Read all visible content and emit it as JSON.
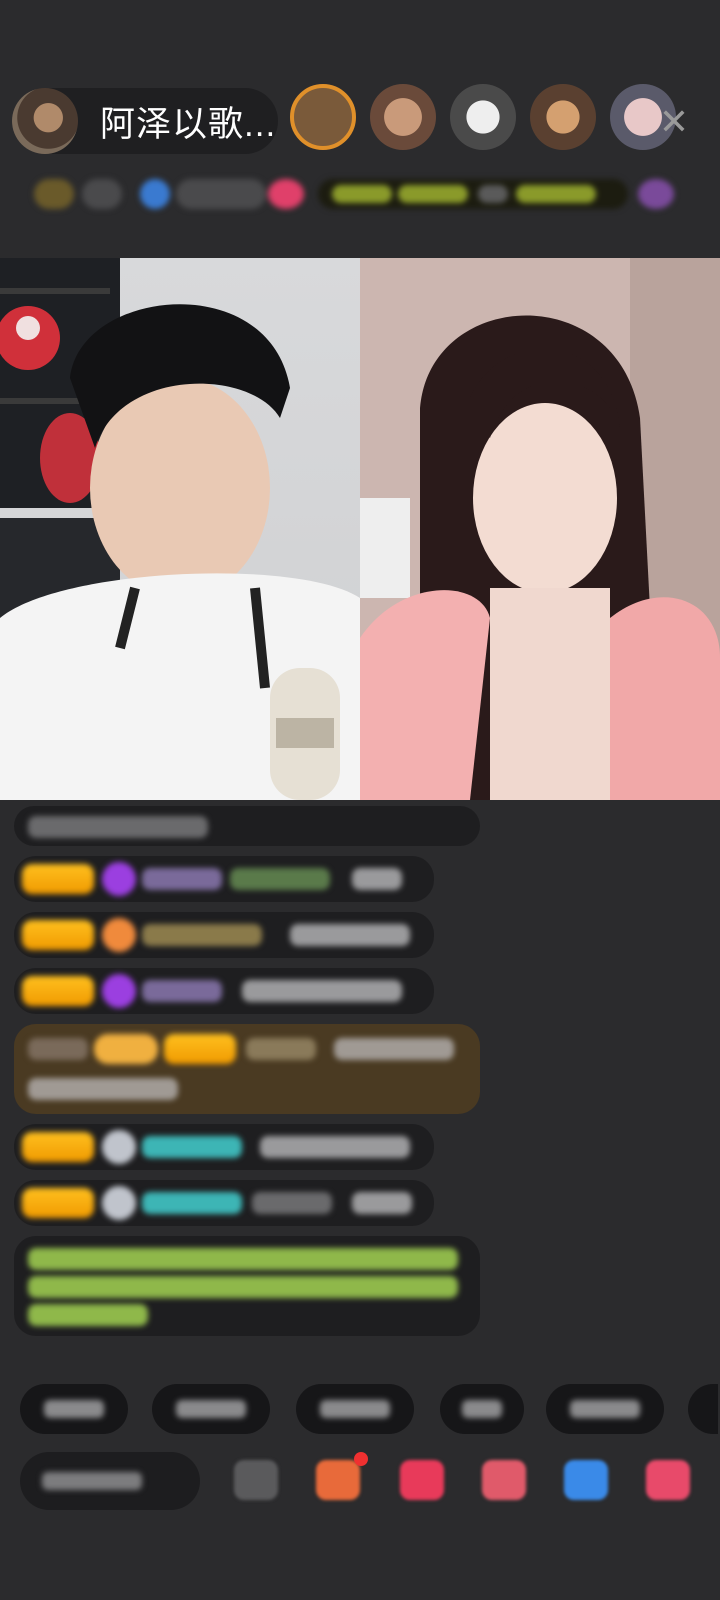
{
  "host": {
    "name": "阿泽以歌..."
  },
  "viewers": {
    "count_shown": 5,
    "icons": [
      "viewer-avatar",
      "viewer-avatar",
      "viewer-avatar",
      "viewer-avatar",
      "viewer-avatar"
    ]
  },
  "close": {
    "icon": "close-icon",
    "label": "✕"
  },
  "colors": {
    "background": "#2b2b2d",
    "badge_gold": "#ffc01e",
    "gift_banner": "#5a4322",
    "purple_gem": "#9b3fe0",
    "orange_gem": "#f08a3c",
    "teal_name": "#3db5b5",
    "green_notice": "#9ccc52"
  },
  "chat": {
    "messages": [
      {
        "type": "system",
        "icon": "none"
      },
      {
        "type": "user",
        "badge": "fan-badge",
        "gem": "purple-gem-icon"
      },
      {
        "type": "user",
        "badge": "fan-badge",
        "gem": "orange-gem-icon"
      },
      {
        "type": "user",
        "badge": "fan-badge",
        "gem": "purple-gem-icon"
      },
      {
        "type": "gift",
        "badge": "gift-banner"
      },
      {
        "type": "user",
        "badge": "fan-badge",
        "gem": "silver-gem-icon"
      },
      {
        "type": "user",
        "badge": "fan-badge",
        "gem": "silver-gem-icon"
      },
      {
        "type": "notice",
        "icon": "none"
      }
    ]
  },
  "quick_replies": {
    "count": 6
  },
  "bottom_bar": {
    "icons": [
      "emoji-icon",
      "gift-box-icon",
      "red-packet-icon",
      "game-icon",
      "chat-icon",
      "more-icon"
    ]
  }
}
